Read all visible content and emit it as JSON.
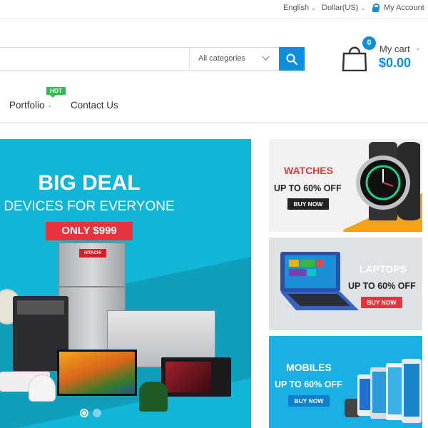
{
  "topbar": {
    "language": "English",
    "currency": "Dollar(US)",
    "account": "My Account"
  },
  "search": {
    "placeholder": "",
    "category": "All categories"
  },
  "cart": {
    "count": "0",
    "label": "My cart",
    "total": "$0.00"
  },
  "nav": {
    "items": [
      {
        "label": "Portfolio",
        "badge": "HOT"
      },
      {
        "label": "Contact Us"
      }
    ]
  },
  "hero": {
    "title": "BIG DEAL",
    "subtitle": "DEVICES FOR EVERYONE",
    "price": "ONLY $999",
    "fridge_brand": "HITACHI",
    "slides": 2,
    "active_slide": 1
  },
  "banners": [
    {
      "title": "WATCHES",
      "offer": "UP TO 60% OFF",
      "button": "BUY NOW"
    },
    {
      "title": "LAPTOPS",
      "offer": "UP TO 60% OFF",
      "button": "BUY NOW"
    },
    {
      "title": "MOBILES",
      "offer": "UP TO 60% OFF",
      "button": "BUY NOW"
    }
  ],
  "colors": {
    "accent": "#0d8fdd",
    "hero_bg": "#11b6d6",
    "sale_red": "#e8323c",
    "hot_green": "#2cc051"
  }
}
